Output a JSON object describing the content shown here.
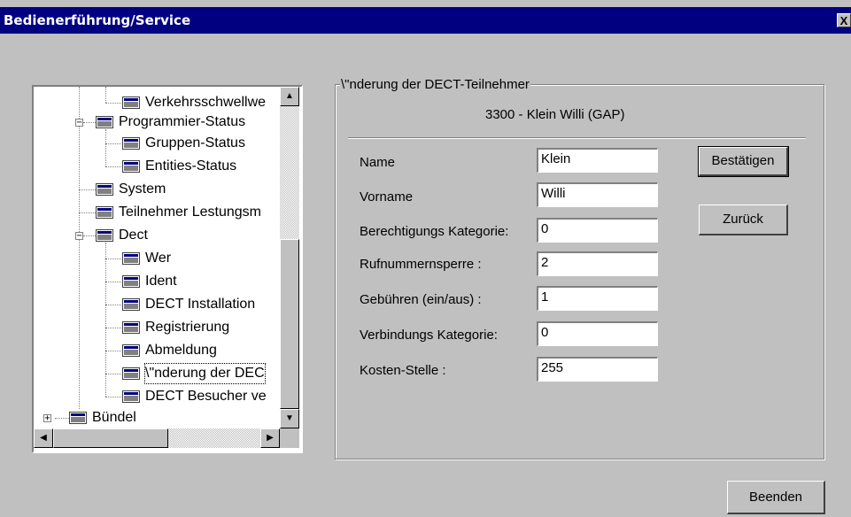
{
  "window": {
    "title": "Bedienerführung/Service",
    "close_label": "X"
  },
  "tree": {
    "items": [
      {
        "label": "Verkehrsschwellwe"
      },
      {
        "label": "Programmier-Status"
      },
      {
        "label": "Gruppen-Status"
      },
      {
        "label": "Entities-Status"
      },
      {
        "label": "System"
      },
      {
        "label": "Teilnehmer Lestungsm"
      },
      {
        "label": "Dect"
      },
      {
        "label": "Wer"
      },
      {
        "label": "Ident"
      },
      {
        "label": "DECT Installation"
      },
      {
        "label": "Registrierung"
      },
      {
        "label": "Abmeldung"
      },
      {
        "label": "\\\"nderung der DEC"
      },
      {
        "label": "DECT Besucher ve"
      },
      {
        "label": "Bündel"
      }
    ],
    "expander_minus": "−",
    "expander_plus": "+",
    "scroll_up": "▲",
    "scroll_down": "▼",
    "scroll_left": "◀",
    "scroll_right": "▶"
  },
  "form": {
    "group_title": "\\\"nderung der DECT-Teilnehmer",
    "subtitle": "3300 - Klein Willi (GAP)",
    "fields": [
      {
        "label": "Name",
        "value": "Klein"
      },
      {
        "label": "Vorname",
        "value": "Willi"
      },
      {
        "label": "Berechtigungs Kategorie:",
        "value": "0"
      },
      {
        "label": "Rufnummernsperre :",
        "value": "2"
      },
      {
        "label": "Gebühren (ein/aus) :",
        "value": "1"
      },
      {
        "label": "Verbindungs Kategorie:",
        "value": "0"
      },
      {
        "label": "Kosten-Stelle :",
        "value": "255"
      }
    ],
    "confirm_label": "Bestätigen",
    "back_label": "Zurück"
  },
  "footer": {
    "exit_label": "Beenden"
  }
}
